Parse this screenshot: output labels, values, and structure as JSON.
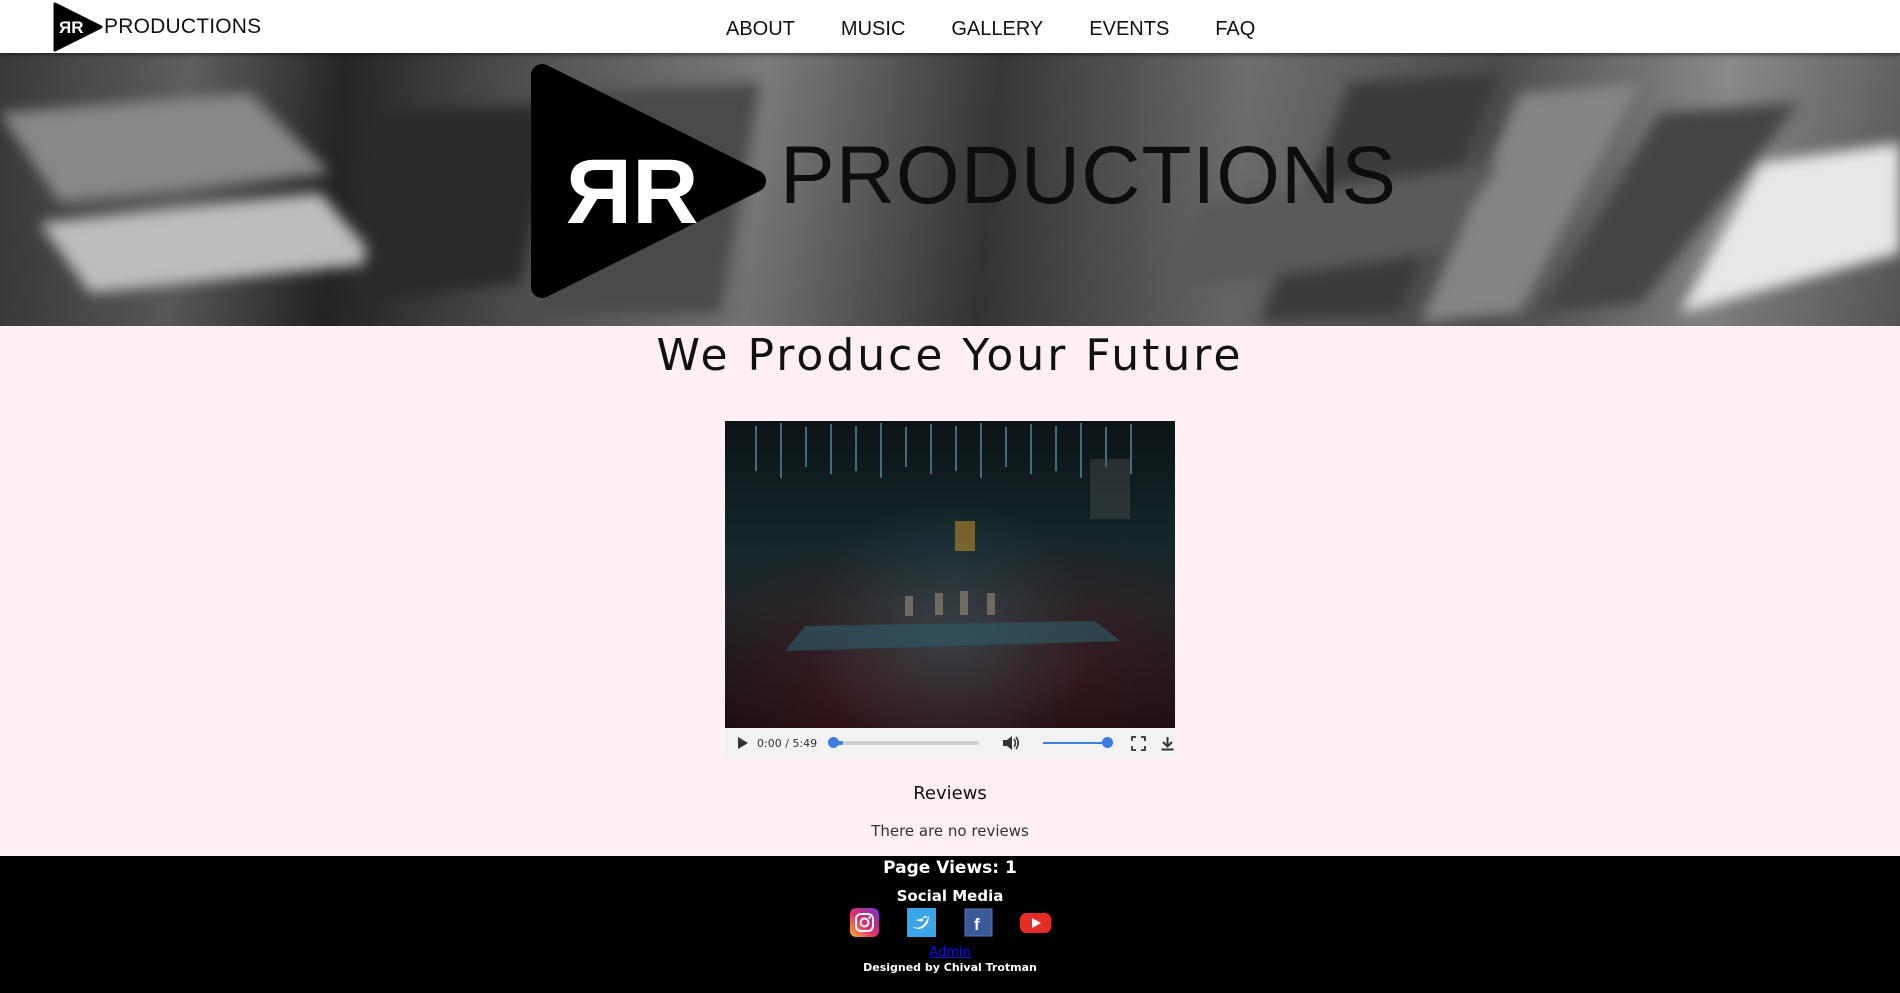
{
  "brand": {
    "name": "PRODUCTIONS",
    "monogram": "ЯR"
  },
  "nav": {
    "items": [
      {
        "label": "ABOUT"
      },
      {
        "label": "MUSIC"
      },
      {
        "label": "GALLERY"
      },
      {
        "label": "EVENTS"
      },
      {
        "label": "FAQ"
      }
    ]
  },
  "hero": {
    "brand_text": "PRODUCTIONS"
  },
  "main": {
    "tagline": "We Produce Your Future",
    "video": {
      "current_time": "0:00",
      "duration": "5:49",
      "time_display": "0:00 / 5:49",
      "progress": 0.0,
      "volume": 1.0
    },
    "reviews_title": "Reviews",
    "reviews_empty": "There are no reviews"
  },
  "footer": {
    "page_views": "Page Views: 1",
    "social_title": "Social Media",
    "social": [
      {
        "name": "instagram-icon"
      },
      {
        "name": "twitter-icon"
      },
      {
        "name": "facebook-icon"
      },
      {
        "name": "youtube-icon"
      }
    ],
    "admin_label": "Admin",
    "credit": "Designed by Chival Trotman"
  },
  "colors": {
    "accent": "#3b7de0",
    "page_bg": "#fdeff3",
    "footer_bg": "#000000"
  }
}
